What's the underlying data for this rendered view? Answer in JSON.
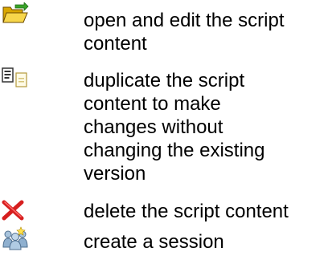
{
  "items": [
    {
      "icon": "open-folder-icon",
      "text": "open and edit the script\ncontent"
    },
    {
      "icon": "duplicate-icon",
      "text": "duplicate the script\ncontent to make\nchanges without\nchanging the existing\nversion"
    },
    {
      "icon": "delete-icon",
      "text": "delete the script content"
    },
    {
      "icon": "session-people-icon",
      "text": "create a session"
    }
  ]
}
